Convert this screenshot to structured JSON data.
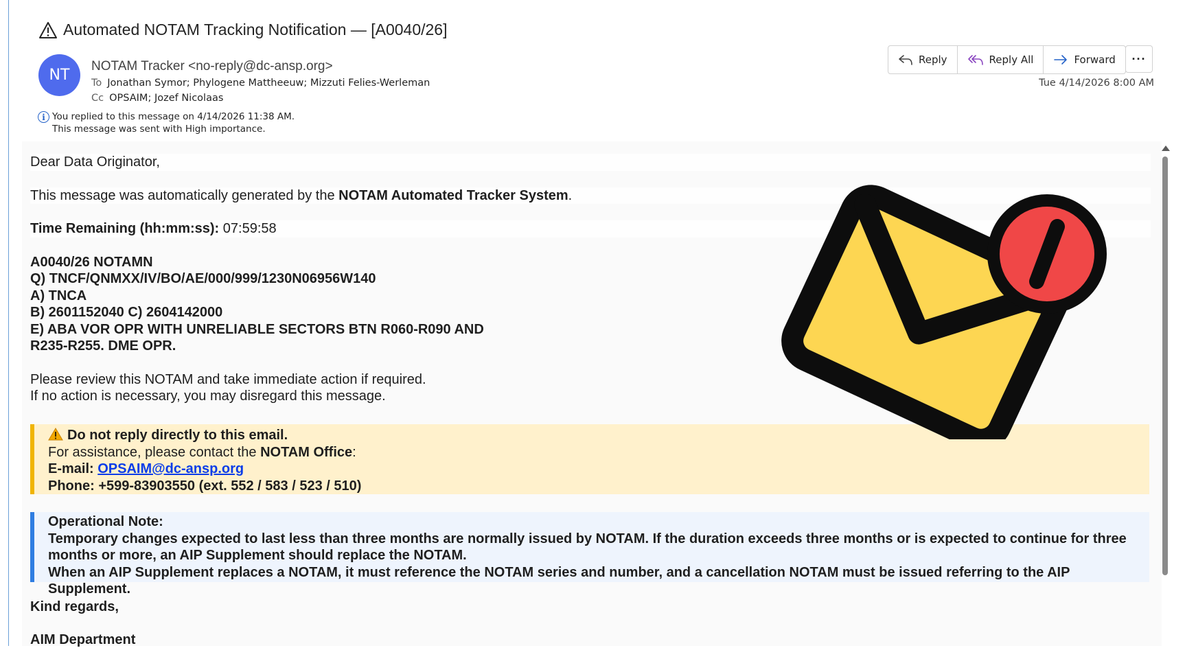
{
  "header": {
    "subject": "Automated NOTAM Tracking Notification — [A0040/26]",
    "avatar_initials": "NT",
    "from": "NOTAM Tracker <no-reply@dc-ansp.org>",
    "to_label": "To",
    "to": "Jonathan Symor; Phylogene Mattheeuw; Mizzuti Felies-Werleman",
    "cc_label": "Cc",
    "cc": "OPSAIM; Jozef Nicolaas",
    "info_replied": "You replied to this message on 4/14/2026 11:38 AM.",
    "info_importance": "This message was sent with High importance.",
    "date": "Tue 4/14/2026 8:00 AM"
  },
  "actions": {
    "reply": "Reply",
    "reply_all": "Reply All",
    "forward": "Forward",
    "more": "···"
  },
  "body": {
    "greeting": "Dear Data Originator,",
    "intro_prefix": "This message was automatically generated by the ",
    "intro_bold": "NOTAM Automated Tracker System",
    "intro_suffix": ".",
    "time_label": "Time Remaining (hh:mm:ss):",
    "time_value": " 07:59:58",
    "notam_lines": [
      "A0040/26 NOTAMN",
      "Q) TNCF/QNMXX/IV/BO/AE/000/999/1230N06956W140",
      "A) TNCA",
      "B) 2601152040 C) 2604142000",
      "E) ABA VOR OPR WITH UNRELIABLE SECTORS BTN R060-R090 AND",
      "R235-R255. DME OPR."
    ],
    "review_1": "Please review this NOTAM and take immediate action if required.",
    "review_2": "If no action is necessary, you may disregard this message.",
    "warn_title": "Do not reply directly to this email.",
    "assist_prefix": "For assistance, please contact the ",
    "assist_bold": "NOTAM Office",
    "assist_suffix": ":",
    "email_label": "E-mail: ",
    "email_value": "OPSAIM@dc-ansp.org",
    "phone": "Phone: +599-83903550 (ext. 552 / 583 / 523 / 510)",
    "note_title": "Operational Note:",
    "note_1": "Temporary changes expected to last less than three months are normally issued by NOTAM. If the duration exceeds three months or is expected to continue for three months or more, an AIP Supplement should replace the NOTAM.",
    "note_2": "When an AIP Supplement replaces a NOTAM, it must reference the NOTAM series and number, and a cancellation NOTAM must be issued referring to the AIP Supplement.",
    "regards": "Kind regards,",
    "department": "AIM Department"
  },
  "colors": {
    "avatar": "#4f6bed",
    "warn_bg": "#fff1cc",
    "warn_bar": "#f0b400",
    "note_bg": "#eef4fd",
    "note_bar": "#2f7de1",
    "envelope": "#fdd652",
    "badge": "#f04747"
  },
  "icons": {
    "subject": "warning-triangle-icon",
    "illustration": "envelope-alert-icon"
  }
}
